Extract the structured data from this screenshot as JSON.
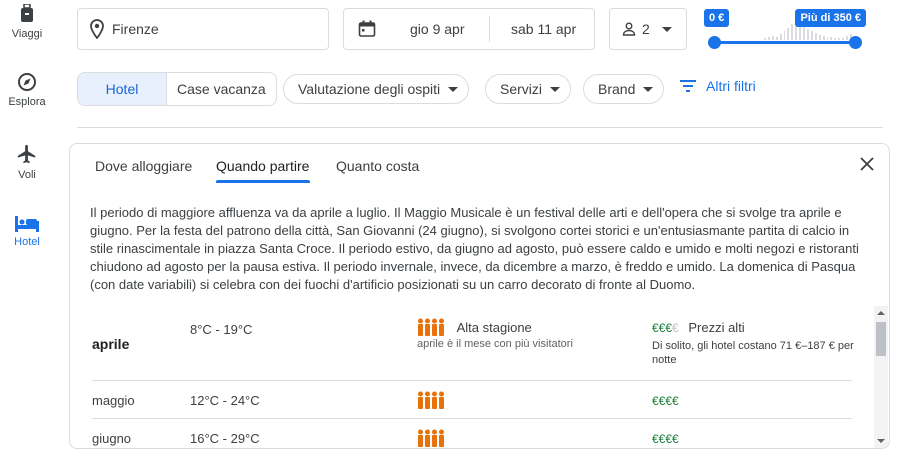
{
  "leftnav": {
    "items": [
      {
        "label": "Viaggi",
        "icon": "suitcase-icon"
      },
      {
        "label": "Esplora",
        "icon": "compass-icon"
      },
      {
        "label": "Voli",
        "icon": "airplane-icon"
      },
      {
        "label": "Hotel",
        "icon": "bed-icon",
        "active": true
      }
    ]
  },
  "search": {
    "location": "Firenze",
    "checkin": "gio 9 apr",
    "checkout": "sab 11 apr",
    "guests": "2"
  },
  "price_filter": {
    "min_label": "0 €",
    "max_label": "Più di 350 €"
  },
  "filters": {
    "segment_hotel": "Hotel",
    "segment_vacation": "Case vacanza",
    "guest_rating": "Valutazione degli ospiti",
    "services": "Servizi",
    "brand": "Brand",
    "more": "Altri filtri"
  },
  "card": {
    "tabs": [
      "Dove alloggiare",
      "Quando partire",
      "Quanto costa"
    ],
    "active_tab": "Quando partire",
    "description": "Il periodo di maggiore affluenza va da aprile a luglio. Il Maggio Musicale è un festival delle arti e dell'opera che si svolge tra aprile e giugno. Per la festa del patrono della città, San Giovanni (24 giugno), si svolgono cortei storici e un'entusiasmante partita di calcio in stile rinascimentale in piazza Santa Croce. Il periodo estivo, da giugno ad agosto, può essere caldo e umido e molti negozi e ristoranti chiudono ad agosto per la pausa estiva. Il periodo invernale, invece, da dicembre a marzo, è freddo e umido. La domenica di Pasqua (con date variabili) si celebra con dei fuochi d'artificio posizionati su un carro decorato di fronte al Duomo.",
    "rows": [
      {
        "month": "aprile",
        "temp": "8°C - 19°C",
        "season_title": "Alta stagione",
        "season_sub": "aprile è il mese con più visitatori",
        "price_on": "€€€",
        "price_off": "€",
        "price_title": "Prezzi alti",
        "price_sub": "Di solito, gli hotel costano 71 €–187 € per notte"
      },
      {
        "month": "maggio",
        "temp": "12°C - 24°C",
        "price_on": "€€€€",
        "price_off": ""
      },
      {
        "month": "giugno",
        "temp": "16°C - 29°C",
        "price_on": "€€€€",
        "price_off": ""
      }
    ]
  },
  "colors": {
    "accent": "#1a73e8",
    "crowd": "#e8710a",
    "price": "#188038"
  }
}
